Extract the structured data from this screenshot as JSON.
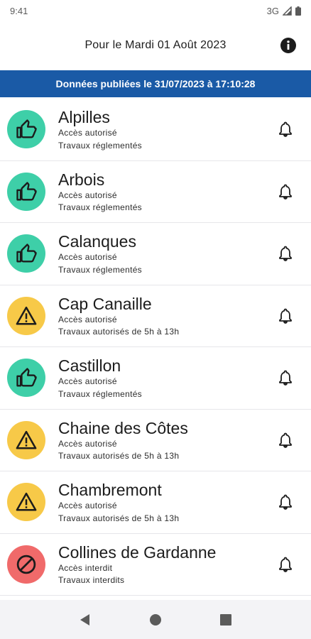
{
  "status_bar": {
    "time": "9:41",
    "network": "3G"
  },
  "header": {
    "title": "Pour le Mardi 01 Août 2023",
    "info_icon": "info-icon"
  },
  "banner": {
    "text": "Données publiées le 31/07/2023 à 17:10:28"
  },
  "colors": {
    "allowed": "#3ecfa8",
    "warning": "#f7c948",
    "forbidden": "#f06a6a",
    "banner": "#1a5aa6"
  },
  "massifs": [
    {
      "name": "Alpilles",
      "access": "Accès autorisé",
      "works": "Travaux réglementés",
      "status": "allowed",
      "icon": "thumbs-up-icon"
    },
    {
      "name": "Arbois",
      "access": "Accès autorisé",
      "works": "Travaux réglementés",
      "status": "allowed",
      "icon": "thumbs-up-icon"
    },
    {
      "name": "Calanques",
      "access": "Accès autorisé",
      "works": "Travaux réglementés",
      "status": "allowed",
      "icon": "thumbs-up-icon"
    },
    {
      "name": "Cap Canaille",
      "access": "Accès autorisé",
      "works": "Travaux autorisés de 5h à 13h",
      "status": "warning",
      "icon": "warning-icon"
    },
    {
      "name": "Castillon",
      "access": "Accès autorisé",
      "works": "Travaux réglementés",
      "status": "allowed",
      "icon": "thumbs-up-icon"
    },
    {
      "name": "Chaine des Côtes",
      "access": "Accès autorisé",
      "works": "Travaux autorisés de 5h à 13h",
      "status": "warning",
      "icon": "warning-icon"
    },
    {
      "name": "Chambremont",
      "access": "Accès autorisé",
      "works": "Travaux autorisés de 5h à 13h",
      "status": "warning",
      "icon": "warning-icon"
    },
    {
      "name": "Collines de Gardanne",
      "access": "Accès interdit",
      "works": "Travaux interdits",
      "status": "forbidden",
      "icon": "forbidden-icon"
    }
  ],
  "nav": {
    "back_icon": "back-icon",
    "home_icon": "home-icon",
    "recents_icon": "recents-icon"
  }
}
